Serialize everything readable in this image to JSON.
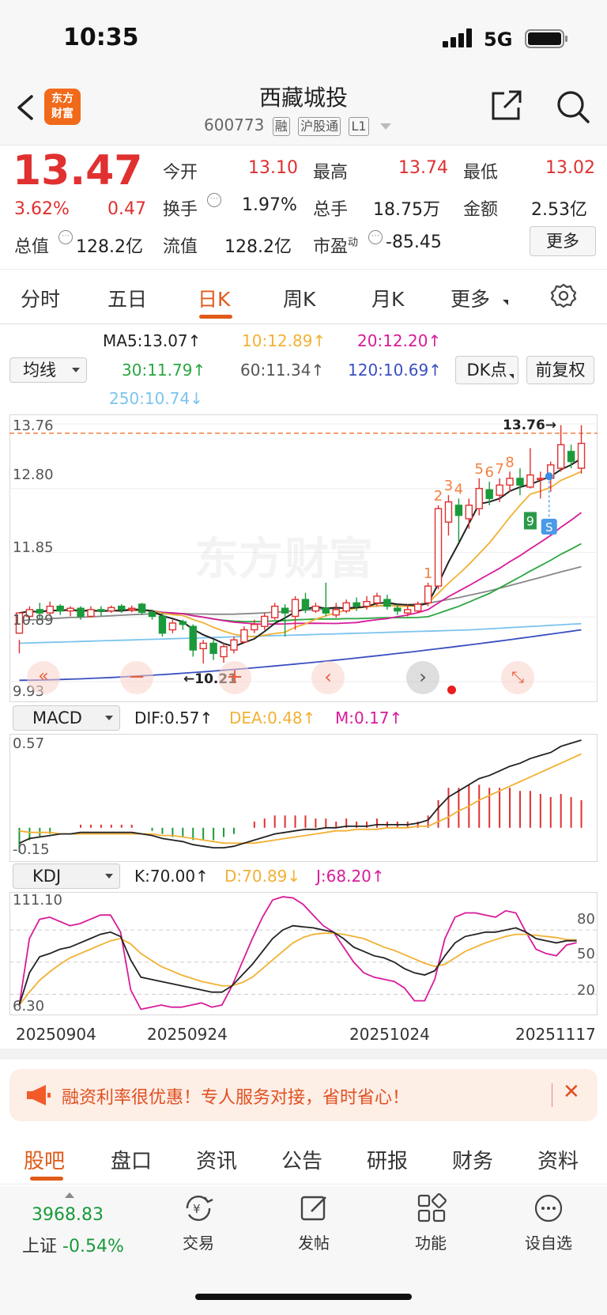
{
  "status": {
    "time": "10:35",
    "network": "5G"
  },
  "header": {
    "logo": [
      "东方",
      "财富"
    ],
    "title": "西藏城投",
    "code": "600773",
    "tags": [
      "融",
      "沪股通",
      "L1"
    ]
  },
  "quote": {
    "price": "13.47",
    "change_pct": "3.62%",
    "change": "0.47",
    "open_label": "今开",
    "open": "13.10",
    "high_label": "最高",
    "high": "13.74",
    "low_label": "最低",
    "low": "13.02",
    "turnover_label": "换手",
    "turnover": "1.97%",
    "volume_label": "总手",
    "volume": "18.75万",
    "amount_label": "金额",
    "amount": "2.53亿",
    "mktcap_label": "总值",
    "mktcap": "128.2亿",
    "float_label": "流值",
    "float": "128.2亿",
    "pe_label": "市盈",
    "pe_sup": "动",
    "pe": "-85.45",
    "more": "更多"
  },
  "tabs": [
    "分时",
    "五日",
    "日K",
    "周K",
    "月K",
    "更多"
  ],
  "active_tab": "日K",
  "ma": {
    "selector": "均线",
    "ma5": "MA5:13.07↑",
    "ma10": "10:12.89↑",
    "ma20": "20:12.20↑",
    "ma30": "30:11.79↑",
    "ma60": "60:11.34↑",
    "ma120": "120:10.69↑",
    "ma250": "250:10.74↓",
    "dk": "DK点",
    "adjust": "前复权"
  },
  "colors": {
    "up": "#e03030",
    "down": "#1a9a3a",
    "ma5": "#222222",
    "ma10": "#f2b134",
    "ma20": "#d81b9a",
    "ma30": "#2aa640",
    "ma60": "#888888",
    "ma120": "#3a4fc0",
    "ma250": "#7cc4ee",
    "accent": "#e05a1a"
  },
  "chart_data": [
    {
      "type": "candlestick",
      "title": "",
      "y_ticks": [
        "13.76",
        "12.80",
        "11.85",
        "10.89",
        "9.93"
      ],
      "ylim": [
        9.93,
        13.76
      ],
      "grid": true,
      "annotations": {
        "high_label": "13.76→",
        "low_label": "←10.21",
        "seq_up": [
          "1",
          "2",
          "3",
          "4",
          "5",
          "6",
          "7",
          "8"
        ],
        "seq_down": "9",
        "sell_mark": "S"
      },
      "candles": [
        [
          10.65,
          10.95,
          10.55,
          10.35
        ],
        [
          10.9,
          11.0,
          11.05,
          10.85
        ],
        [
          11.0,
          10.95,
          11.1,
          10.85
        ],
        [
          10.95,
          11.05,
          11.12,
          10.9
        ],
        [
          11.05,
          10.98,
          11.08,
          10.92
        ],
        [
          10.98,
          11.02,
          11.05,
          10.9
        ],
        [
          11.02,
          10.9,
          11.05,
          10.85
        ],
        [
          10.9,
          11.0,
          11.05,
          10.88
        ],
        [
          11.0,
          10.98,
          11.05,
          10.9
        ],
        [
          10.98,
          11.03,
          11.06,
          10.95
        ],
        [
          11.05,
          11.0,
          11.08,
          10.95
        ],
        [
          11.0,
          11.02,
          11.06,
          10.96
        ],
        [
          11.08,
          10.96,
          11.1,
          10.92
        ],
        [
          10.96,
          10.9,
          11.0,
          10.85
        ],
        [
          10.9,
          10.65,
          10.95,
          10.6
        ],
        [
          10.7,
          10.8,
          10.85,
          10.65
        ],
        [
          10.82,
          10.78,
          10.85,
          10.7
        ],
        [
          10.75,
          10.4,
          10.78,
          10.3
        ],
        [
          10.42,
          10.5,
          10.55,
          10.2
        ],
        [
          10.5,
          10.35,
          10.55,
          10.25
        ],
        [
          10.3,
          10.45,
          10.5,
          10.21
        ],
        [
          10.4,
          10.55,
          10.6,
          10.35
        ],
        [
          10.52,
          10.7,
          10.75,
          10.5
        ],
        [
          10.7,
          10.78,
          10.85,
          10.65
        ],
        [
          10.75,
          10.9,
          10.95,
          10.7
        ],
        [
          10.88,
          11.05,
          11.1,
          10.85
        ],
        [
          11.02,
          10.95,
          11.08,
          10.6
        ],
        [
          10.9,
          11.15,
          11.2,
          10.7
        ],
        [
          11.15,
          11.0,
          11.25,
          10.95
        ],
        [
          10.98,
          11.05,
          11.1,
          10.95
        ],
        [
          11.02,
          10.95,
          11.4,
          10.9
        ],
        [
          10.92,
          11.0,
          11.1,
          10.88
        ],
        [
          10.98,
          11.1,
          11.15,
          10.95
        ],
        [
          11.1,
          11.05,
          11.18,
          10.98
        ],
        [
          11.05,
          11.12,
          11.2,
          11.0
        ],
        [
          11.1,
          11.2,
          11.25,
          11.05
        ],
        [
          11.15,
          11.05,
          11.22,
          11.0
        ],
        [
          11.02,
          10.98,
          11.08,
          10.92
        ],
        [
          10.95,
          11.0,
          11.08,
          10.9
        ],
        [
          10.98,
          11.08,
          11.12,
          10.95
        ],
        [
          11.1,
          11.35,
          11.4,
          11.05
        ],
        [
          11.35,
          12.5,
          12.55,
          11.3
        ],
        [
          12.3,
          12.6,
          12.7,
          12.1
        ],
        [
          12.55,
          12.4,
          12.65,
          12.0
        ],
        [
          12.35,
          12.55,
          12.65,
          12.2
        ],
        [
          12.5,
          12.8,
          12.95,
          12.4
        ],
        [
          12.78,
          12.65,
          12.9,
          12.55
        ],
        [
          12.7,
          12.85,
          12.95,
          12.6
        ],
        [
          12.85,
          12.95,
          13.05,
          12.75
        ],
        [
          12.95,
          12.85,
          13.1,
          12.7
        ],
        [
          12.82,
          13.0,
          13.4,
          12.8
        ],
        [
          12.95,
          12.95,
          13.05,
          12.65
        ],
        [
          12.95,
          13.15,
          13.2,
          12.75
        ],
        [
          13.1,
          13.45,
          13.74,
          13.05
        ],
        [
          13.35,
          13.2,
          13.45,
          13.1
        ],
        [
          13.1,
          13.47,
          13.74,
          13.02
        ]
      ]
    },
    {
      "type": "bar",
      "title": "MACD",
      "selector": "MACD",
      "dif_label": "DIF:0.57↑",
      "dea_label": "DEA:0.48↑",
      "m_label": "M:0.17↑",
      "y_ticks": [
        "0.57",
        "-0.15"
      ],
      "ylim": [
        -0.15,
        0.57
      ],
      "series": [
        {
          "name": "DIF",
          "values": [
            -0.1,
            -0.07,
            -0.06,
            -0.05,
            -0.04,
            -0.04,
            -0.03,
            -0.03,
            -0.03,
            -0.03,
            -0.03,
            -0.03,
            -0.04,
            -0.05,
            -0.07,
            -0.08,
            -0.09,
            -0.11,
            -0.12,
            -0.13,
            -0.13,
            -0.12,
            -0.1,
            -0.08,
            -0.06,
            -0.04,
            -0.03,
            -0.02,
            -0.01,
            -0.01,
            0.0,
            0.0,
            0.01,
            0.01,
            0.01,
            0.02,
            0.02,
            0.02,
            0.02,
            0.03,
            0.05,
            0.13,
            0.2,
            0.24,
            0.28,
            0.32,
            0.34,
            0.37,
            0.4,
            0.42,
            0.45,
            0.47,
            0.49,
            0.53,
            0.55,
            0.57
          ]
        },
        {
          "name": "DEA",
          "values": [
            -0.02,
            -0.03,
            -0.03,
            -0.03,
            -0.04,
            -0.04,
            -0.04,
            -0.04,
            -0.04,
            -0.04,
            -0.04,
            -0.04,
            -0.04,
            -0.04,
            -0.05,
            -0.05,
            -0.06,
            -0.07,
            -0.08,
            -0.09,
            -0.1,
            -0.1,
            -0.1,
            -0.1,
            -0.09,
            -0.08,
            -0.07,
            -0.06,
            -0.05,
            -0.04,
            -0.03,
            -0.02,
            -0.02,
            -0.01,
            -0.01,
            -0.01,
            0.0,
            0.0,
            0.0,
            0.01,
            0.01,
            0.04,
            0.07,
            0.11,
            0.14,
            0.18,
            0.21,
            0.24,
            0.27,
            0.3,
            0.33,
            0.36,
            0.39,
            0.42,
            0.45,
            0.48
          ]
        }
      ]
    },
    {
      "type": "line",
      "title": "KDJ",
      "selector": "KDJ",
      "k_label": "K:70.00↑",
      "d_label": "D:70.89↓",
      "j_label": "J:68.20↑",
      "y_ticks": [
        "111.10",
        "6.30"
      ],
      "right_ticks": [
        "80",
        "50",
        "20"
      ],
      "ylim": [
        6.3,
        111.1
      ],
      "x_ticks": [
        "20250904",
        "20250924",
        "20251024",
        "20251117"
      ],
      "series": [
        {
          "name": "K",
          "values": [
            10,
            40,
            55,
            58,
            62,
            64,
            68,
            72,
            76,
            78,
            74,
            52,
            36,
            34,
            32,
            30,
            28,
            26,
            24,
            22,
            22,
            28,
            38,
            48,
            60,
            72,
            80,
            84,
            83,
            82,
            80,
            78,
            72,
            64,
            60,
            56,
            54,
            50,
            44,
            40,
            38,
            42,
            56,
            68,
            74,
            76,
            78,
            78,
            80,
            82,
            78,
            72,
            70,
            68,
            70,
            70
          ]
        },
        {
          "name": "D",
          "values": [
            10,
            22,
            33,
            41,
            48,
            54,
            58,
            62,
            66,
            70,
            72,
            67,
            58,
            52,
            46,
            42,
            38,
            35,
            32,
            30,
            28,
            28,
            31,
            36,
            44,
            52,
            60,
            68,
            73,
            76,
            77,
            77,
            76,
            74,
            72,
            68,
            64,
            61,
            57,
            53,
            49,
            46,
            48,
            54,
            60,
            64,
            68,
            71,
            74,
            76,
            76,
            75,
            74,
            73,
            71,
            70.89
          ]
        },
        {
          "name": "J",
          "values": [
            10,
            72,
            90,
            92,
            88,
            84,
            86,
            90,
            94,
            94,
            78,
            24,
            6,
            8,
            10,
            8,
            8,
            10,
            12,
            8,
            10,
            28,
            50,
            72,
            92,
            108,
            111,
            110,
            104,
            94,
            84,
            78,
            64,
            50,
            40,
            36,
            34,
            32,
            26,
            14,
            14,
            34,
            72,
            92,
            96,
            96,
            94,
            92,
            98,
            96,
            78,
            62,
            58,
            56,
            66,
            68.2
          ]
        }
      ]
    }
  ],
  "banner": {
    "text": "融资利率很优惠！专人服务对接，省时省心！"
  },
  "bottom_tabs": [
    "股吧",
    "盘口",
    "资讯",
    "公告",
    "研报",
    "财务",
    "资料"
  ],
  "footer": {
    "index_value": "3968.83",
    "index_name": "上证",
    "index_change": "-0.54%",
    "items": [
      "交易",
      "发帖",
      "功能",
      "设自选"
    ]
  }
}
